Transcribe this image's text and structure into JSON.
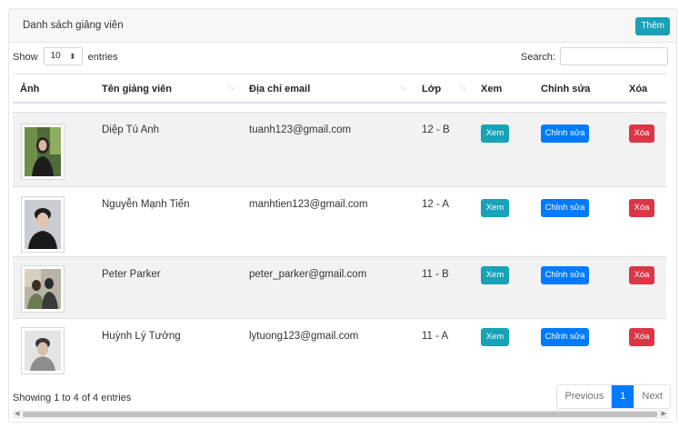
{
  "header": {
    "title": "Danh sách giảng viên",
    "add_label": "Thêm"
  },
  "controls": {
    "show_label": "Show",
    "entries_value": "10",
    "entries_label": "entries",
    "search_label": "Search:",
    "search_value": ""
  },
  "columns": {
    "photo": "Ảnh",
    "name": "Tên giảng viên",
    "email": "Địa chỉ email",
    "class": "Lớp",
    "view": "Xem",
    "edit": "Chỉnh sửa",
    "delete": "Xóa"
  },
  "rows": [
    {
      "name": "Diệp Tú Anh",
      "email": "tuanh123@gmail.com",
      "class": "12 - B",
      "view": "Xem",
      "edit": "Chỉnh sửa",
      "delete": "Xóa"
    },
    {
      "name": "Nguyễn Mạnh Tiến",
      "email": "manhtien123@gmail.com",
      "class": "12 - A",
      "view": "Xem",
      "edit": "Chỉnh sửa",
      "delete": "Xóa"
    },
    {
      "name": "Peter Parker",
      "email": "peter_parker@gmail.com",
      "class": "11 - B",
      "view": "Xem",
      "edit": "Chỉnh sửa",
      "delete": "Xóa"
    },
    {
      "name": "Huỳnh Lý Tưởng",
      "email": "lytuong123@gmail.com",
      "class": "11 - A",
      "view": "Xem",
      "edit": "Chỉnh sửa",
      "delete": "Xóa"
    }
  ],
  "footer": {
    "info": "Showing 1 to 4 of 4 entries"
  },
  "pagination": {
    "previous": "Previous",
    "current": "1",
    "next": "Next"
  },
  "icons": {
    "sort": "sort-arrows-icon",
    "select_caret": "updown-caret-icon",
    "scroll_left": "scroll-left-icon",
    "scroll_right": "scroll-right-icon"
  },
  "colors": {
    "info": "#17a2b8",
    "primary": "#007bff",
    "danger": "#dc3545",
    "stripe": "#f2f2f2"
  }
}
